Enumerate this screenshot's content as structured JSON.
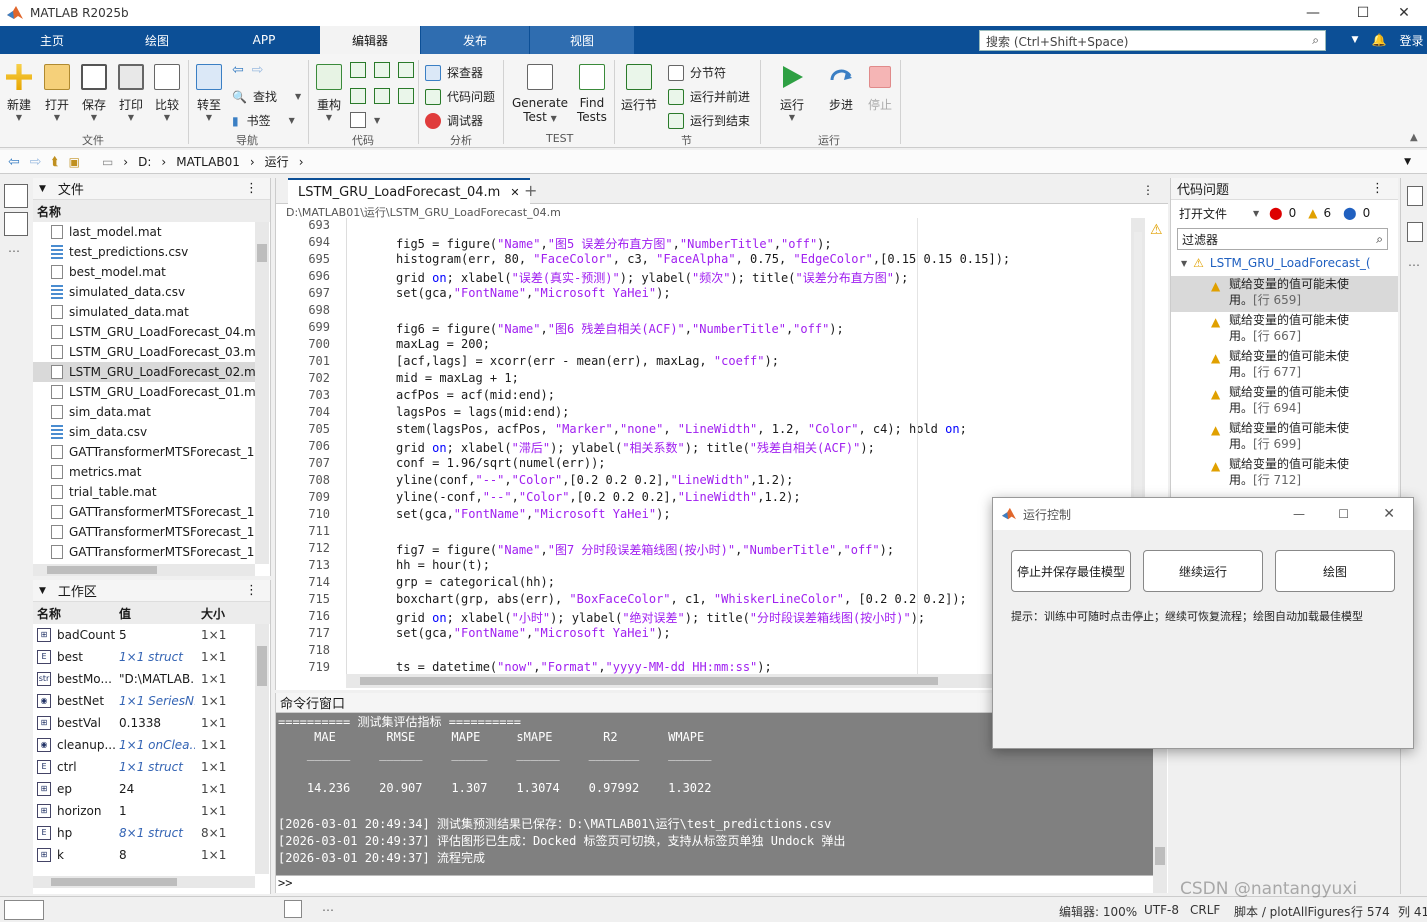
{
  "window": {
    "title": "MATLAB R2025b",
    "controls": [
      "—",
      "☐",
      "✕"
    ]
  },
  "ribbon": {
    "tabs": [
      "主页",
      "绘图",
      "APP",
      "编辑器",
      "发布",
      "视图"
    ],
    "login": "登录",
    "search_placeholder": "搜索 (Ctrl+Shift+Space)"
  },
  "toolstrip": {
    "file": {
      "new": "新建",
      "open": "打开",
      "save": "保存",
      "print": "打印",
      "compare": "比较",
      "group": "文件"
    },
    "nav": {
      "goto": "转至",
      "find": "查找",
      "bookmark": "书签",
      "group": "导航"
    },
    "code": {
      "refactor": "重构",
      "group": "代码"
    },
    "analyze": {
      "explorer": "探查器",
      "issues": "代码问题",
      "debugger": "调试器",
      "group": "分析"
    },
    "test": {
      "generate1": "Generate",
      "generate2": "Test",
      "find1": "Find",
      "find2": "Tests",
      "group": "TEST"
    },
    "section": {
      "run_section": "运行节",
      "break": "分节符",
      "run_advance": "运行并前进",
      "run_to_end": "运行到结束",
      "group": "节"
    },
    "run": {
      "run": "运行",
      "step": "步进",
      "stop": "停止",
      "group": "运行"
    }
  },
  "address": {
    "parts": [
      "D:",
      "MATLAB01",
      "运行"
    ]
  },
  "files": {
    "title": "文件",
    "col": "名称",
    "items": [
      "last_model.mat",
      "test_predictions.csv",
      "best_model.mat",
      "simulated_data.csv",
      "simulated_data.mat",
      "LSTM_GRU_LoadForecast_04.m",
      "LSTM_GRU_LoadForecast_03.m",
      "LSTM_GRU_LoadForecast_02.m",
      "LSTM_GRU_LoadForecast_01.m",
      "sim_data.mat",
      "sim_data.csv",
      "GATTransformerMTSForecast_14.m",
      "metrics.mat",
      "trial_table.mat",
      "GATTransformerMTSForecast_13.m",
      "GATTransformerMTSForecast_12.m",
      "GATTransformerMTSForecast_11.m"
    ]
  },
  "workspace": {
    "title": "工作区",
    "cols": [
      "名称",
      "值",
      "大小"
    ],
    "rows": [
      {
        "name": "badCount",
        "value": "5",
        "size": "1×1",
        "kind": "num"
      },
      {
        "name": "best",
        "value": "1×1 struct",
        "size": "1×1",
        "kind": "struct"
      },
      {
        "name": "bestMo...",
        "value": "\"D:\\MATLAB...",
        "size": "1×1",
        "kind": "str"
      },
      {
        "name": "bestNet",
        "value": "1×1 SeriesN...",
        "size": "1×1",
        "kind": "obj"
      },
      {
        "name": "bestVal",
        "value": "0.1338",
        "size": "1×1",
        "kind": "num"
      },
      {
        "name": "cleanup...",
        "value": "1×1 onClea...",
        "size": "1×1",
        "kind": "obj"
      },
      {
        "name": "ctrl",
        "value": "1×1 struct",
        "size": "1×1",
        "kind": "struct"
      },
      {
        "name": "ep",
        "value": "24",
        "size": "1×1",
        "kind": "num"
      },
      {
        "name": "horizon",
        "value": "1",
        "size": "1×1",
        "kind": "num"
      },
      {
        "name": "hp",
        "value": "8×1 struct",
        "size": "8×1",
        "kind": "struct"
      },
      {
        "name": "k",
        "value": "8",
        "size": "1×1",
        "kind": "num"
      }
    ]
  },
  "editor": {
    "tab": "LSTM_GRU_LoadForecast_04.m",
    "path": "D:\\MATLAB01\\运行\\LSTM_GRU_LoadForecast_04.m",
    "lines": [
      {
        "n": "693",
        "c": ""
      },
      {
        "n": "694",
        "c": "fig5 = figure(\"Name\",\"图5 误差分布直方图\",\"NumberTitle\",\"off\");"
      },
      {
        "n": "695",
        "c": "histogram(err, 80, \"FaceColor\", c3, \"FaceAlpha\", 0.75, \"EdgeColor\",[0.15 0.15 0.15]);"
      },
      {
        "n": "696",
        "c": "grid on; xlabel(\"误差(真实-预测)\"); ylabel(\"频次\"); title(\"误差分布直方图\");"
      },
      {
        "n": "697",
        "c": "set(gca,\"FontName\",\"Microsoft YaHei\");"
      },
      {
        "n": "698",
        "c": ""
      },
      {
        "n": "699",
        "c": "fig6 = figure(\"Name\",\"图6 残差自相关(ACF)\",\"NumberTitle\",\"off\");"
      },
      {
        "n": "700",
        "c": "maxLag = 200;"
      },
      {
        "n": "701",
        "c": "[acf,lags] = xcorr(err - mean(err), maxLag, \"coeff\");"
      },
      {
        "n": "702",
        "c": "mid = maxLag + 1;"
      },
      {
        "n": "703",
        "c": "acfPos = acf(mid:end);"
      },
      {
        "n": "704",
        "c": "lagsPos = lags(mid:end);"
      },
      {
        "n": "705",
        "c": "stem(lagsPos, acfPos, \"Marker\",\"none\", \"LineWidth\", 1.2, \"Color\", c4); hold on;"
      },
      {
        "n": "706",
        "c": "grid on; xlabel(\"滞后\"); ylabel(\"相关系数\"); title(\"残差自相关(ACF)\");"
      },
      {
        "n": "707",
        "c": "conf = 1.96/sqrt(numel(err));"
      },
      {
        "n": "708",
        "c": "yline(conf,\"--\",\"Color\",[0.2 0.2 0.2],\"LineWidth\",1.2);"
      },
      {
        "n": "709",
        "c": "yline(-conf,\"--\",\"Color\",[0.2 0.2 0.2],\"LineWidth\",1.2);"
      },
      {
        "n": "710",
        "c": "set(gca,\"FontName\",\"Microsoft YaHei\");"
      },
      {
        "n": "711",
        "c": ""
      },
      {
        "n": "712",
        "c": "fig7 = figure(\"Name\",\"图7 分时段误差箱线图(按小时)\",\"NumberTitle\",\"off\");"
      },
      {
        "n": "713",
        "c": "hh = hour(t);"
      },
      {
        "n": "714",
        "c": "grp = categorical(hh);"
      },
      {
        "n": "715",
        "c": "boxchart(grp, abs(err), \"BoxFaceColor\", c1, \"WhiskerLineColor\", [0.2 0.2 0.2]);"
      },
      {
        "n": "716",
        "c": "grid on; xlabel(\"小时\"); ylabel(\"绝对误差\"); title(\"分时段误差箱线图(按小时)\");"
      },
      {
        "n": "717",
        "c": "set(gca,\"FontName\",\"Microsoft YaHei\");"
      },
      {
        "n": "718",
        "c": ""
      },
      {
        "n": "719",
        "c": "ts = datetime(\"now\",\"Format\",\"yyyy-MM-dd HH:mm:ss\");"
      }
    ]
  },
  "command": {
    "title": "命令行窗口",
    "lines": [
      "========== 测试集评估指标 ==========",
      "     MAE       RMSE     MAPE     sMAPE       R2       WMAPE ",
      "    ______    ______    _____    ______    _______    ______",
      "",
      "    14.236    20.907    1.307    1.3074    0.97992    1.3022",
      "",
      "[2026-03-01 20:49:34] 测试集预测结果已保存：D:\\MATLAB01\\运行\\test_predictions.csv",
      "[2026-03-01 20:49:37] 评估图形已生成：Docked 标签页可切换，支持从标签页单独 Undock 弹出",
      "[2026-03-01 20:49:37] 流程完成"
    ],
    "prompt": ">>"
  },
  "issues": {
    "title": "代码问题",
    "scope": "打开文件",
    "errors": "0",
    "warnings": "6",
    "infos": "0",
    "filter": "过滤器",
    "file": "LSTM_GRU_LoadForecast_(",
    "items": [
      {
        "msg": "赋给变量的值可能未使",
        "msg2": "用。",
        "ref": "[行 659]"
      },
      {
        "msg": "赋给变量的值可能未使",
        "msg2": "用。",
        "ref": "[行 667]"
      },
      {
        "msg": "赋给变量的值可能未使",
        "msg2": "用。",
        "ref": "[行 677]"
      },
      {
        "msg": "赋给变量的值可能未使",
        "msg2": "用。",
        "ref": "[行 694]"
      },
      {
        "msg": "赋给变量的值可能未使",
        "msg2": "用。",
        "ref": "[行 699]"
      },
      {
        "msg": "赋给变量的值可能未使",
        "msg2": "用。",
        "ref": "[行 712]"
      }
    ]
  },
  "dialog": {
    "title": "运行控制",
    "btn_stop": "停止并保存最佳模型",
    "btn_continue": "继续运行",
    "btn_plot": "绘图",
    "hint": "提示：训练中可随时点击停止；继续可恢复流程；绘图自动加载最佳模型"
  },
  "status": {
    "zoom": "编辑器: 100%",
    "enc": "UTF-8",
    "eol": "CRLF",
    "script": "脚本 / plotAllFigures",
    "pos": "行 574",
    "col": "列 41",
    "watermark": "CSDN @nantangyuxi"
  }
}
